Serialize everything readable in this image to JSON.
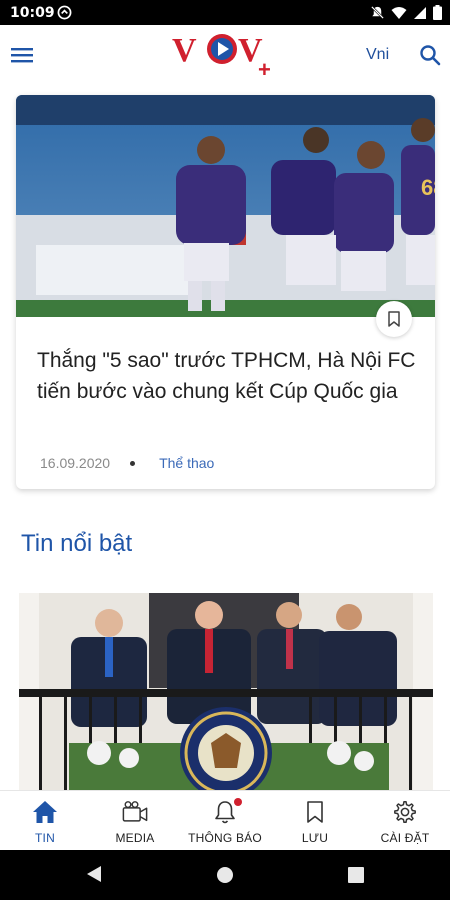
{
  "status_bar": {
    "time": "10:09"
  },
  "app_bar": {
    "logo_text": "VOV",
    "logo_plus": "+",
    "language": "Vni"
  },
  "article": {
    "title": "Thắng \"5 sao\" trước TPHCM, Hà Nội FC tiến bước vào chung kết Cúp Quốc gia",
    "date": "16.09.2020",
    "category": "Thể thao"
  },
  "featured": {
    "section_title": "Tin nổi bật"
  },
  "bottom_nav": {
    "items": [
      {
        "label": "TIN",
        "icon": "home-icon",
        "active": true
      },
      {
        "label": "MEDIA",
        "icon": "video-icon",
        "active": false
      },
      {
        "label": "THÔNG BÁO",
        "icon": "bell-icon",
        "active": false
      },
      {
        "label": "LƯU",
        "icon": "bookmark-icon",
        "active": false
      },
      {
        "label": "CÀI ĐẶT",
        "icon": "gear-icon",
        "active": false
      }
    ]
  },
  "colors": {
    "brand_red": "#d0202e",
    "brand_blue": "#1f55a8",
    "category_blue": "#3b6ab8"
  }
}
